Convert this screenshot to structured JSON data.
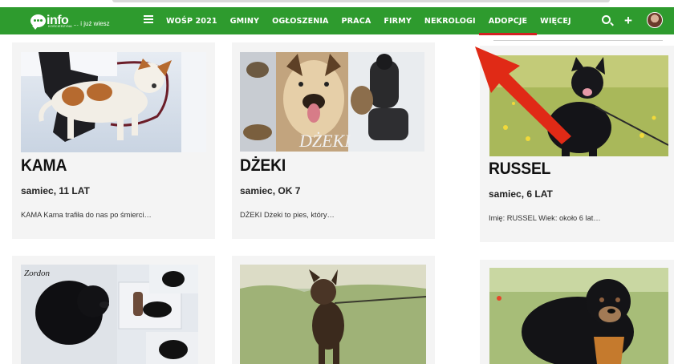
{
  "header": {
    "logo_word": "info",
    "logo_sub": "KOŚCIERZYNA",
    "logo_tag": "... i już wiesz",
    "menu": [
      "WOŚP 2021",
      "GMINY",
      "OGŁOSZENIA",
      "PRACA",
      "FIRMY",
      "NEKROLOGI",
      "ADOPCJE",
      "WIĘCEJ"
    ],
    "active_item": "ADOPCJE"
  },
  "cards": [
    {
      "name": "KAMA",
      "meta": "samiec, 11 LAT",
      "excerpt": "KAMA Kama trafiła do nas po śmierci…"
    },
    {
      "name": "DŻEKI",
      "meta": "samiec, OK 7",
      "excerpt": "DŻEKI Dżeki to pies, który…",
      "photo_caption": "DŻEKI"
    },
    {
      "name": "RUSSEL",
      "meta": "samiec, 6 LAT",
      "excerpt": "Imię: RUSSEL Wiek: około 6 lat…"
    },
    {
      "name": "",
      "meta": "",
      "excerpt": "",
      "photo_caption": "Zordon"
    },
    {
      "name": "",
      "meta": "",
      "excerpt": ""
    },
    {
      "name": "",
      "meta": "",
      "excerpt": ""
    }
  ],
  "colors": {
    "nav": "#2e9b2e",
    "active_underline": "#d22222",
    "arrow": "#e02a16",
    "card_bg": "#f4f4f4"
  }
}
